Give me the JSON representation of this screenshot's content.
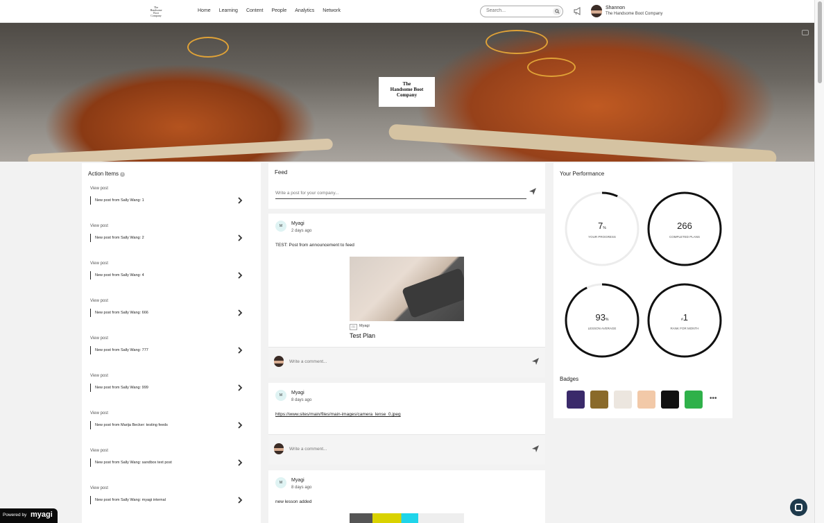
{
  "nav": {
    "logo_text": "The Handsome Boot Company",
    "items": [
      "Home",
      "Learning",
      "Content",
      "People",
      "Analytics",
      "Network"
    ],
    "search_placeholder": "Search...",
    "user_name": "Shannon",
    "user_company": "The Handsome Boot Company"
  },
  "hero": {
    "logo_line1": "The",
    "logo_line2": "Handsome Boot",
    "logo_line3": "Company"
  },
  "action_items": {
    "title": "Action Items",
    "items": [
      {
        "view": "View post",
        "text": "New post from Sally Wang: 1"
      },
      {
        "view": "View post",
        "text": "New post from Sally Wang: 2"
      },
      {
        "view": "View post",
        "text": "New post from Sally Wang: 4"
      },
      {
        "view": "View post",
        "text": "New post from Sally Wang: 666"
      },
      {
        "view": "View post",
        "text": "New post from Sally Wang: 777"
      },
      {
        "view": "View post",
        "text": "New post from Sally Wang: 999"
      },
      {
        "view": "View post",
        "text": "New post from Marija Becker: testing feeds"
      },
      {
        "view": "View post",
        "text": "New post from Sally Wang: sandbox text post"
      },
      {
        "view": "View post",
        "text": "New post from Sally Wang: myagi internal"
      }
    ]
  },
  "feed": {
    "title": "Feed",
    "post_placeholder": "Write a post for your company...",
    "comment_placeholder": "Write a comment...",
    "posts": [
      {
        "avatar": "M",
        "author": "Myagi",
        "time": "2 days ago",
        "body": "TEST: Post from announcement to feed",
        "attachment_source": "Myagi",
        "attachment_title": "Test Plan"
      },
      {
        "avatar": "M",
        "author": "Myagi",
        "time": "8 days ago",
        "link": "https://www.sites/main/files/main-images/camera_lense_0.jpeg"
      },
      {
        "avatar": "M",
        "author": "Myagi",
        "time": "8 days ago",
        "body": "new lesson added"
      }
    ]
  },
  "performance": {
    "title": "Your Performance",
    "stats": [
      {
        "value": "7",
        "unit": "%",
        "label": "YOUR PROGRESS",
        "progress": 0.07
      },
      {
        "value": "266",
        "unit": "",
        "label": "COMPLETED PLANS",
        "progress": 1
      },
      {
        "value": "93",
        "unit": "%",
        "label": "LESSON AVERAGE",
        "progress": 0.93
      },
      {
        "value": "1",
        "unit": "#",
        "label": "RANK FOR MONTH",
        "progress": 1
      }
    ],
    "badges_title": "Badges",
    "badge_colors": [
      "#3a2a6a",
      "#8a6a2a",
      "#ece6df",
      "#f2c9a8",
      "#111111",
      "#2fb14a"
    ],
    "more": "•••"
  },
  "footer": {
    "powered_by": "Powered by",
    "brand": "myagi"
  }
}
